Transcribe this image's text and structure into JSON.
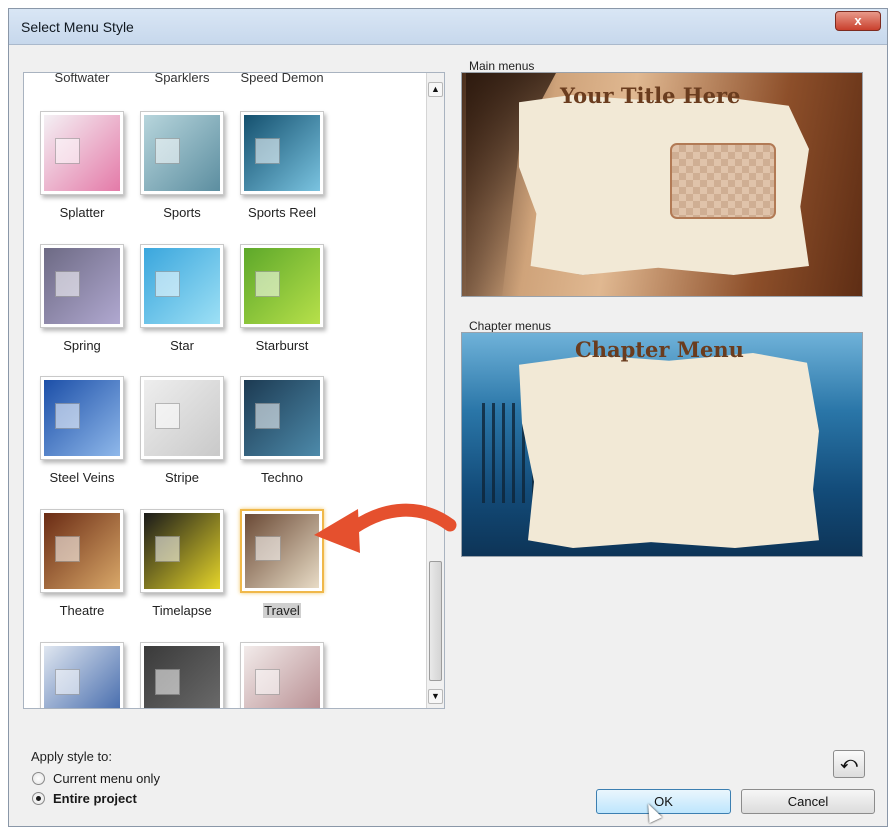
{
  "window": {
    "title": "Select Menu Style",
    "close_label": "x"
  },
  "style_list": {
    "partial_top_labels": [
      "Softwater",
      "Sparklers",
      "Speed Demon"
    ],
    "tiles": [
      {
        "label": "Splatter",
        "colors": [
          "#f4f0f4",
          "#e47aa8"
        ]
      },
      {
        "label": "Sports",
        "colors": [
          "#b7d5dc",
          "#5c8ea0"
        ]
      },
      {
        "label": "Sports Reel",
        "colors": [
          "#14506e",
          "#7ac3e0"
        ]
      },
      {
        "label": "Spring",
        "colors": [
          "#6d6a84",
          "#b0a8d0"
        ]
      },
      {
        "label": "Star",
        "colors": [
          "#3aa6dd",
          "#9de0f5"
        ]
      },
      {
        "label": "Starburst",
        "colors": [
          "#5da82a",
          "#b7e04a"
        ]
      },
      {
        "label": "Steel Veins",
        "colors": [
          "#1c4fa8",
          "#8fb8ea"
        ]
      },
      {
        "label": "Stripe",
        "colors": [
          "#eeeeee",
          "#c9c9c9"
        ]
      },
      {
        "label": "Techno",
        "colors": [
          "#1c3a52",
          "#4d8aaa"
        ]
      },
      {
        "label": "Theatre",
        "colors": [
          "#6a2b14",
          "#d9a869"
        ]
      },
      {
        "label": "Timelapse",
        "colors": [
          "#1a1a1a",
          "#e5d52a"
        ]
      },
      {
        "label": "Travel",
        "colors": [
          "#6b4a36",
          "#e8dcc6"
        ],
        "selected": true
      },
      {
        "label": "",
        "colors": [
          "#dfe6f0",
          "#3b63a8"
        ]
      },
      {
        "label": "",
        "colors": [
          "#3a3a3a",
          "#6e6e6e"
        ]
      },
      {
        "label": "",
        "colors": [
          "#f2ebea",
          "#b4888c"
        ]
      }
    ]
  },
  "previews": {
    "main_label": "Main menus",
    "main_title": "Your Title Here",
    "chapter_label": "Chapter menus",
    "chapter_title": "Chapter Menu"
  },
  "apply": {
    "label": "Apply style to:",
    "current_menu_only": "Current menu only",
    "entire_project": "Entire project",
    "selected": "entire_project"
  },
  "buttons": {
    "ok": "OK",
    "cancel": "Cancel"
  },
  "colors": {
    "selection_border": "#f0b84a",
    "ok_border": "#3c7fb1",
    "arrow": "#e5502e"
  }
}
